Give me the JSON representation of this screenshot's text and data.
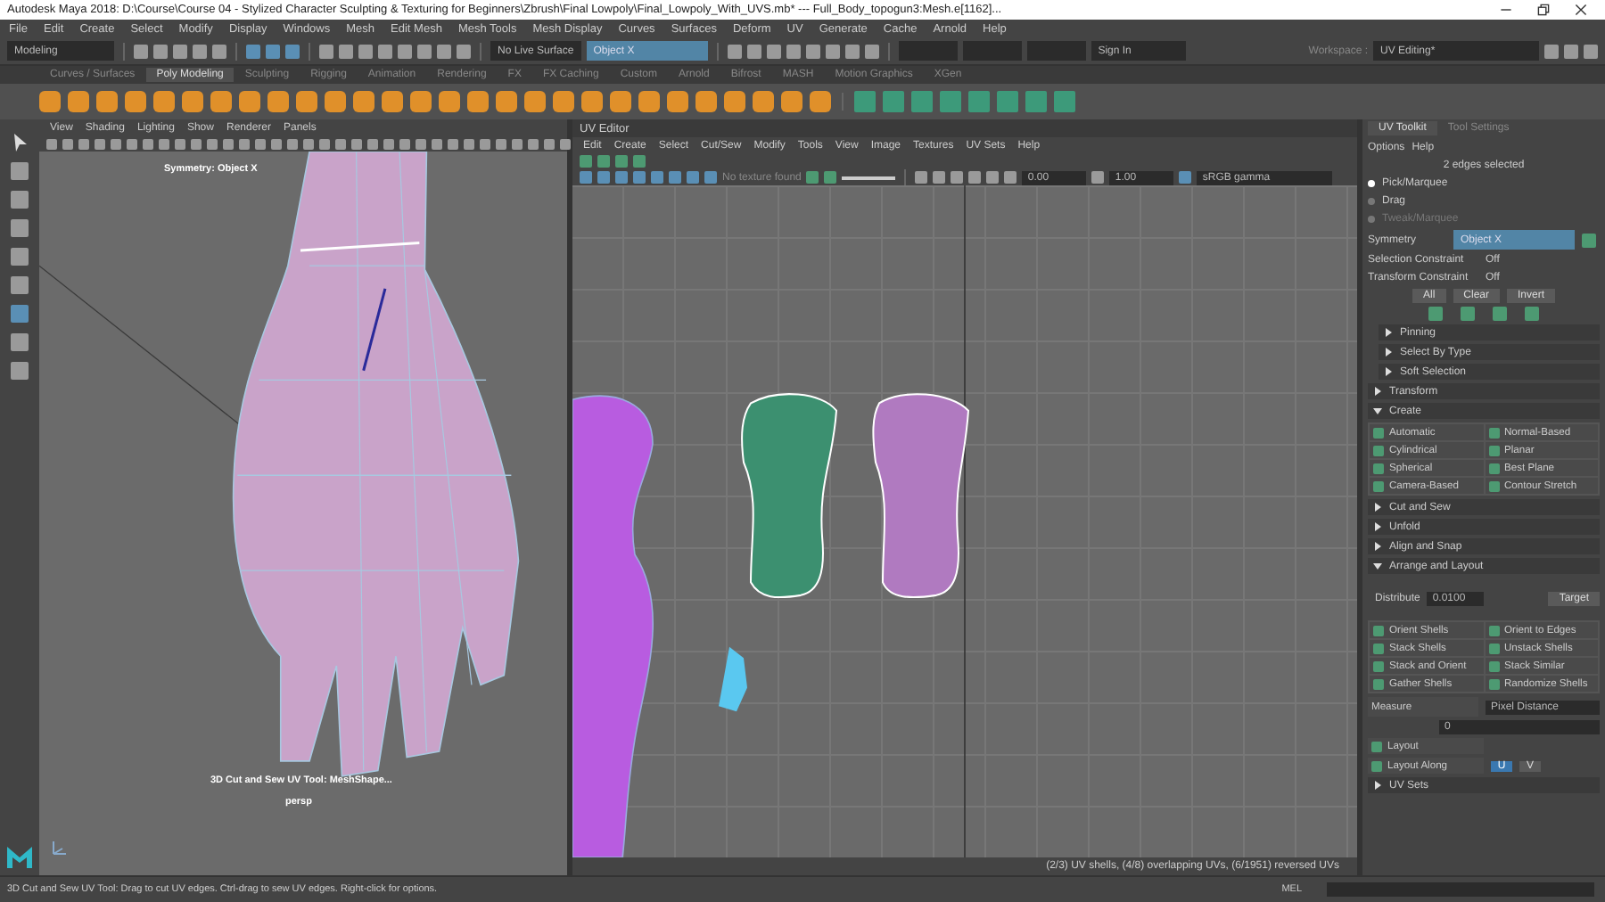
{
  "window": {
    "title": "Autodesk Maya 2018: D:\\Course\\Course 04 - Stylized Character Sculpting & Texturing for Beginners\\Zbrush\\Final Lowpoly\\Final_Lowpoly_With_UVS.mb*  ---  Full_Body_topogun3:Mesh.e[1162]..."
  },
  "menu_bar": [
    "File",
    "Edit",
    "Create",
    "Select",
    "Modify",
    "Display",
    "Windows",
    "Mesh",
    "Edit Mesh",
    "Mesh Tools",
    "Mesh Display",
    "Curves",
    "Surfaces",
    "Deform",
    "UV",
    "Generate",
    "Cache",
    "Arnold",
    "Help"
  ],
  "status_line": {
    "mode": "Modeling",
    "live_surface": "No Live Surface",
    "symmetry": "Object X",
    "sign_in": "Sign In",
    "workspace_label": "Workspace :",
    "workspace": "UV Editing*"
  },
  "shelf": {
    "tabs": [
      {
        "label": "Curves / Surfaces",
        "selected": false
      },
      {
        "label": "Poly Modeling",
        "selected": true
      },
      {
        "label": "Sculpting",
        "selected": false
      },
      {
        "label": "Rigging",
        "selected": false
      },
      {
        "label": "Animation",
        "selected": false
      },
      {
        "label": "Rendering",
        "selected": false
      },
      {
        "label": "FX",
        "selected": false
      },
      {
        "label": "FX Caching",
        "selected": false
      },
      {
        "label": "Custom",
        "selected": false
      },
      {
        "label": "Arnold",
        "selected": false
      },
      {
        "label": "Bifrost",
        "selected": false
      },
      {
        "label": "MASH",
        "selected": false
      },
      {
        "label": "Motion Graphics",
        "selected": false
      },
      {
        "label": "XGen",
        "selected": false
      }
    ]
  },
  "viewport": {
    "menus": [
      "View",
      "Shading",
      "Lighting",
      "Show",
      "Renderer",
      "Panels"
    ],
    "symmetry_label": "Symmetry: Object X",
    "hud_tool": "3D Cut and Sew UV Tool: MeshShape...",
    "camera": "persp"
  },
  "uv_editor": {
    "title": "UV Editor",
    "menus": [
      "Edit",
      "Create",
      "Select",
      "Cut/Sew",
      "Modify",
      "Tools",
      "View",
      "Image",
      "Textures",
      "UV Sets",
      "Help"
    ],
    "texture_status": "No texture found",
    "exposure": "0.00",
    "gamma": "1.00",
    "color_space": "sRGB gamma",
    "info": "(2/3) UV shells, (4/8) overlapping UVs, (6/1951) reversed UVs"
  },
  "uv_toolkit": {
    "tabs": [
      {
        "label": "UV Toolkit",
        "selected": true
      },
      {
        "label": "Tool Settings",
        "selected": false
      }
    ],
    "menus": [
      "Options",
      "Help"
    ],
    "selection_info": "2 edges selected",
    "pick_modes": [
      {
        "label": "Pick/Marquee",
        "selected": true,
        "disabled": false
      },
      {
        "label": "Drag",
        "selected": false,
        "disabled": false
      },
      {
        "label": "Tweak/Marquee",
        "selected": false,
        "disabled": true
      }
    ],
    "symmetry": {
      "label": "Symmetry",
      "value": "Object X"
    },
    "constraints": [
      {
        "label": "Selection Constraint",
        "value": "Off"
      },
      {
        "label": "Transform Constraint",
        "value": "Off"
      }
    ],
    "selection_buttons": [
      "All",
      "Clear",
      "Invert"
    ],
    "subsections": [
      {
        "label": "Pinning",
        "expanded": false
      },
      {
        "label": "Select By Type",
        "expanded": false
      },
      {
        "label": "Soft Selection",
        "expanded": false
      }
    ],
    "sections": [
      {
        "label": "Transform",
        "expanded": false
      },
      {
        "label": "Create",
        "expanded": true,
        "kind": "create",
        "buttons": [
          "Automatic",
          "Normal-Based",
          "Cylindrical",
          "Planar",
          "Spherical",
          "Best Plane",
          "Camera-Based",
          "Contour Stretch"
        ]
      },
      {
        "label": "Cut and Sew",
        "expanded": false
      },
      {
        "label": "Unfold",
        "expanded": false
      },
      {
        "label": "Align and Snap",
        "expanded": false
      },
      {
        "label": "Arrange and Layout",
        "expanded": true,
        "kind": "arrange",
        "distribute_label": "Distribute",
        "distribute_value": "0.0100",
        "target": "Target",
        "buttons": [
          "Orient Shells",
          "Orient to Edges",
          "Stack Shells",
          "Unstack Shells",
          "Stack and Orient",
          "Stack Similar",
          "Gather Shells",
          "Randomize Shells"
        ],
        "measure": "Measure",
        "measure_unit": "Pixel Distance",
        "measure_value": "0",
        "layout": "Layout",
        "layout_along": "Layout Along",
        "axes": [
          {
            "label": "U",
            "selected": true
          },
          {
            "label": "V",
            "selected": false
          }
        ]
      },
      {
        "label": "UV Sets",
        "expanded": false
      }
    ]
  },
  "help_line": "3D Cut and Sew UV Tool: Drag to cut UV edges. Ctrl-drag to sew UV edges. Right-click for options.",
  "command_language": "MEL"
}
